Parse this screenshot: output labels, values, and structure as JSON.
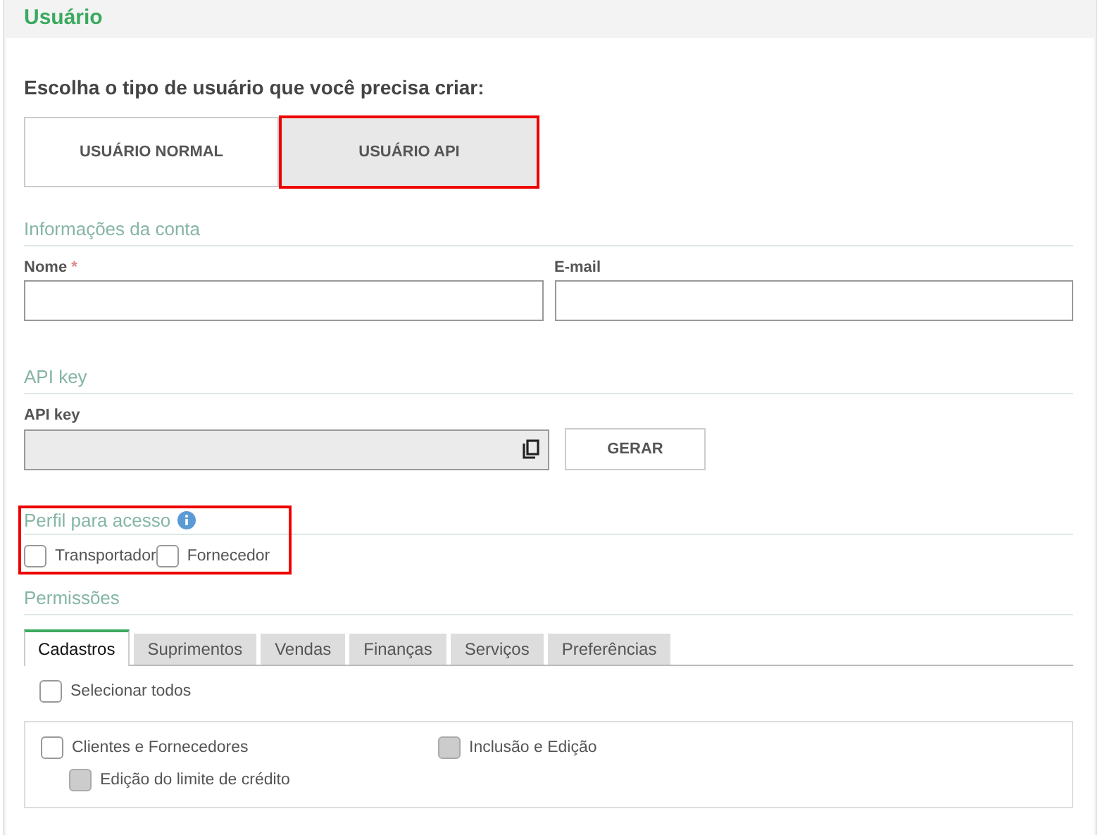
{
  "page_title": "Usuário",
  "prompt": "Escolha o tipo de usuário que você precisa criar:",
  "user_types": [
    {
      "label": "USUÁRIO NORMAL",
      "selected": false,
      "highlighted": false
    },
    {
      "label": "USUÁRIO API",
      "selected": true,
      "highlighted": true
    }
  ],
  "account": {
    "heading": "Informações da conta",
    "fields": [
      {
        "label": "Nome",
        "required_mark": "*"
      },
      {
        "label": "E-mail"
      }
    ]
  },
  "api_key": {
    "heading": "API key",
    "label": "API key",
    "disabled": true,
    "button": "GERAR"
  },
  "profile": {
    "heading": "Perfil para acesso",
    "highlighted": true,
    "options": [
      {
        "label": "Transportador",
        "checked": false
      },
      {
        "label": "Fornecedor",
        "checked": false
      }
    ]
  },
  "permissions": {
    "heading": "Permissões",
    "tabs": [
      {
        "label": "Cadastros",
        "selected": true
      },
      {
        "label": "Suprimentos",
        "selected": false
      },
      {
        "label": "Vendas",
        "selected": false
      },
      {
        "label": "Finanças",
        "selected": false
      },
      {
        "label": "Serviços",
        "selected": false
      },
      {
        "label": "Preferências",
        "selected": false
      }
    ],
    "select_all": {
      "label": "Selecionar todos",
      "checked": false
    },
    "items": [
      {
        "label": "Clientes e Fornecedores",
        "checked": false,
        "disabled": false,
        "children": [
          {
            "label": "Edição do limite de crédito",
            "checked": false,
            "disabled": true
          }
        ]
      },
      {
        "label": "Inclusão e Edição",
        "checked": false,
        "disabled": true
      }
    ]
  }
}
